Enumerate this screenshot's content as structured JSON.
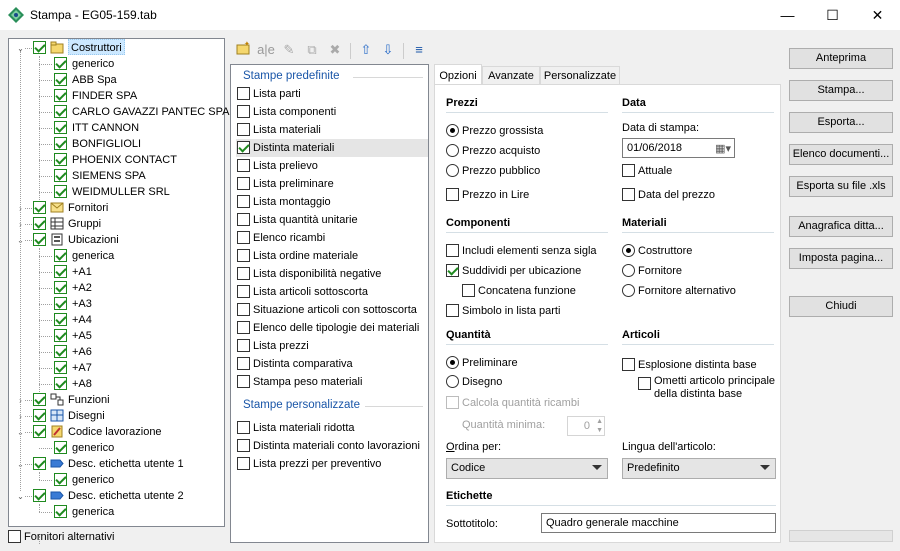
{
  "window": {
    "title": "Stampa - EG05-159.tab",
    "minimize": "—",
    "maximize": "☐",
    "close": "✕"
  },
  "tree": {
    "items": [
      {
        "label": "Costruttori",
        "level": 1,
        "checked": true,
        "expand": "−",
        "icon": "folder-icon",
        "selected": true
      },
      {
        "label": "generico",
        "level": 2,
        "checked": true
      },
      {
        "label": "ABB Spa",
        "level": 2,
        "checked": true
      },
      {
        "label": "FINDER SPA",
        "level": 2,
        "checked": true
      },
      {
        "label": "CARLO GAVAZZI PANTEC SPA",
        "level": 2,
        "checked": true
      },
      {
        "label": "ITT CANNON",
        "level": 2,
        "checked": true
      },
      {
        "label": "BONFIGLIOLI",
        "level": 2,
        "checked": true
      },
      {
        "label": "PHOENIX CONTACT",
        "level": 2,
        "checked": true
      },
      {
        "label": "SIEMENS SPA",
        "level": 2,
        "checked": true
      },
      {
        "label": "WEIDMULLER SRL",
        "level": 2,
        "checked": true
      },
      {
        "label": "Fornitori",
        "level": 1,
        "checked": true,
        "expand": "›",
        "icon": "envelope-icon"
      },
      {
        "label": "Gruppi",
        "level": 1,
        "checked": true,
        "expand": "›",
        "icon": "grid-icon"
      },
      {
        "label": "Ubicazioni",
        "level": 1,
        "checked": true,
        "expand": "−",
        "icon": "rack-icon"
      },
      {
        "label": "generica",
        "level": 2,
        "checked": true
      },
      {
        "label": "+A1",
        "level": 2,
        "checked": true
      },
      {
        "label": "+A2",
        "level": 2,
        "checked": true
      },
      {
        "label": "+A3",
        "level": 2,
        "checked": true
      },
      {
        "label": "+A4",
        "level": 2,
        "checked": true
      },
      {
        "label": "+A5",
        "level": 2,
        "checked": true
      },
      {
        "label": "+A6",
        "level": 2,
        "checked": true
      },
      {
        "label": "+A7",
        "level": 2,
        "checked": true
      },
      {
        "label": "+A8",
        "level": 2,
        "checked": true
      },
      {
        "label": "Funzioni",
        "level": 1,
        "checked": true,
        "expand": "›",
        "icon": "function-icon"
      },
      {
        "label": "Disegni",
        "level": 1,
        "checked": true,
        "expand": "›",
        "icon": "drawing-icon"
      },
      {
        "label": "Codice lavorazione",
        "level": 1,
        "checked": true,
        "expand": "−",
        "icon": "tools-icon"
      },
      {
        "label": "generico",
        "level": 2,
        "checked": true
      },
      {
        "label": "Desc. etichetta utente 1",
        "level": 1,
        "checked": true,
        "expand": "−",
        "icon": "label-icon"
      },
      {
        "label": "generico",
        "level": 2,
        "checked": true
      },
      {
        "label": "Desc. etichetta utente 2",
        "level": 1,
        "checked": true,
        "expand": "−",
        "icon": "label-icon"
      },
      {
        "label": "generica",
        "level": 2,
        "checked": true
      }
    ],
    "footer_checkbox": "Fornitori alternativi"
  },
  "toolbar": {
    "items": [
      "new-icon",
      "rename-icon",
      "edit-icon",
      "copy-icon",
      "delete-icon",
      "move-up-icon",
      "move-down-icon",
      "menu-icon"
    ]
  },
  "report_list": {
    "section_predef": "Stampe predefinite",
    "predefined": [
      {
        "label": "Lista parti",
        "checked": false
      },
      {
        "label": "Lista componenti",
        "checked": false
      },
      {
        "label": "Lista materiali",
        "checked": false
      },
      {
        "label": "Distinta materiali",
        "checked": true,
        "selected": true
      },
      {
        "label": "Lista prelievo",
        "checked": false
      },
      {
        "label": "Lista preliminare",
        "checked": false
      },
      {
        "label": "Lista montaggio",
        "checked": false
      },
      {
        "label": "Lista quantità unitarie",
        "checked": false
      },
      {
        "label": "Elenco ricambi",
        "checked": false
      },
      {
        "label": "Lista ordine materiale",
        "checked": false
      },
      {
        "label": "Lista disponibilità negative",
        "checked": false
      },
      {
        "label": "Lista articoli sottoscorta",
        "checked": false
      },
      {
        "label": "Situazione articoli con sottoscorta",
        "checked": false
      },
      {
        "label": "Elenco delle tipologie dei materiali",
        "checked": false
      },
      {
        "label": "Lista prezzi",
        "checked": false
      },
      {
        "label": "Distinta comparativa",
        "checked": false
      },
      {
        "label": "Stampa peso materiali",
        "checked": false
      }
    ],
    "section_custom": "Stampe personalizzate",
    "custom": [
      {
        "label": "Lista materiali ridotta",
        "checked": false
      },
      {
        "label": "Distinta materiali conto lavorazioni",
        "checked": false
      },
      {
        "label": "Lista prezzi per preventivo",
        "checked": false
      }
    ]
  },
  "tabs": [
    "Opzioni",
    "Avanzate",
    "Personalizzate"
  ],
  "options": {
    "prezzi": {
      "title": "Prezzi",
      "radios": [
        {
          "label": "Prezzo grossista",
          "on": true
        },
        {
          "label": "Prezzo acquisto",
          "on": false
        },
        {
          "label": "Prezzo pubblico",
          "on": false
        }
      ],
      "lire": "Prezzo in Lire"
    },
    "data": {
      "title": "Data",
      "date_label": "Data di stampa:",
      "date_value": "01/06/2018",
      "attuale": "Attuale",
      "data_prezzo": "Data del prezzo"
    },
    "componenti": {
      "title": "Componenti",
      "items": [
        {
          "label": "Includi elementi senza sigla",
          "checked": false
        },
        {
          "label": "Suddividi per ubicazione",
          "checked": true
        },
        {
          "label": "Concatena funzione",
          "checked": false
        },
        {
          "label": "Simbolo in lista parti",
          "checked": false
        }
      ]
    },
    "materiali": {
      "title": "Materiali",
      "radios": [
        {
          "label": "Costruttore",
          "on": true
        },
        {
          "label": "Fornitore",
          "on": false
        },
        {
          "label": "Fornitore alternativo",
          "on": false
        }
      ]
    },
    "quantita": {
      "title": "Quantità",
      "preliminare": "Preliminare",
      "disegno": "Disegno",
      "calcola": "Calcola quantità ricambi",
      "min_label": "Quantità minima:",
      "min_value": "0"
    },
    "articoli": {
      "title": "Articoli",
      "esplosione": "Esplosione distinta base",
      "ometti": "Ometti articolo principale della distinta base"
    },
    "ordina": {
      "label": "Ordina per:",
      "value": "Codice"
    },
    "lingua": {
      "label": "Lingua dell'articolo:",
      "value": "Predefinito"
    },
    "etichette": {
      "title": "Etichette",
      "sottotitolo_label": "Sottotitolo:",
      "sottotitolo_value": "Quadro generale macchine"
    }
  },
  "buttons": [
    "Anteprima",
    "Stampa...",
    "Esporta...",
    "Elenco documenti...",
    "Esporta su file .xls",
    "Anagrafica ditta...",
    "Imposta pagina...",
    "Chiudi"
  ]
}
